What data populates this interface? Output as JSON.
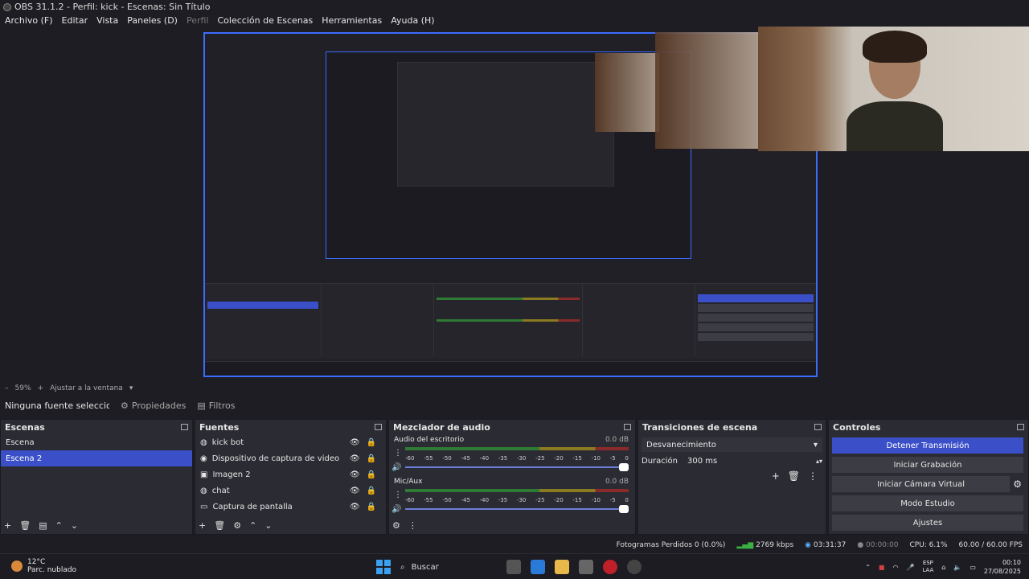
{
  "window": {
    "title": "OBS 31.1.2 - Perfil: kick - Escenas: Sin Título"
  },
  "menu": {
    "items": [
      "Archivo (F)",
      "Editar",
      "Vista",
      "Paneles (D)",
      "Perfil",
      "Colección de Escenas",
      "Herramientas",
      "Ayuda (H)"
    ]
  },
  "preview": {
    "zoom": "59%",
    "fit_label": "Ajustar a la ventana"
  },
  "source_bar": {
    "selected_label": "Ninguna fuente seleccionada",
    "properties_label": "Propiedades",
    "filters_label": "Filtros"
  },
  "scenes": {
    "title": "Escenas",
    "items": [
      {
        "label": "Escena",
        "selected": false
      },
      {
        "label": "Escena 2",
        "selected": true
      }
    ]
  },
  "sources": {
    "title": "Fuentes",
    "items": [
      {
        "label": "kick bot",
        "icon": "globe-icon"
      },
      {
        "label": "Dispositivo de captura de video",
        "icon": "camera-icon"
      },
      {
        "label": "Imagen 2",
        "icon": "image-icon"
      },
      {
        "label": "chat",
        "icon": "globe-icon"
      },
      {
        "label": "Captura de pantalla",
        "icon": "monitor-icon"
      }
    ]
  },
  "mixer": {
    "title": "Mezclador de audio",
    "channels": [
      {
        "name": "Audio del escritorio",
        "db": "0.0 dB"
      },
      {
        "name": "Mic/Aux",
        "db": "0.0 dB"
      }
    ],
    "scale": [
      "-60",
      "-55",
      "-50",
      "-45",
      "-40",
      "-35",
      "-30",
      "-25",
      "-20",
      "-15",
      "-10",
      "-5",
      "0"
    ]
  },
  "transitions": {
    "title": "Transiciones de escena",
    "selected": "Desvanecimiento",
    "duration_label": "Duración",
    "duration_value": "300 ms"
  },
  "controls": {
    "title": "Controles",
    "buttons": [
      "Detener Transmisión",
      "Iniciar Grabación",
      "Iniciar Cámara Virtual",
      "Modo Estudio",
      "Ajustes"
    ]
  },
  "status": {
    "dropped_frames": "Fotogramas Perdidos 0 (0.0%)",
    "bitrate": "2769 kbps",
    "stream_time": "03:31:37",
    "record_time": "00:00:00",
    "cpu": "CPU: 6.1%",
    "fps": "60.00 / 60.00 FPS"
  },
  "taskbar": {
    "weather_temp": "12°C",
    "weather_desc": "Parc. nublado",
    "search_label": "Buscar",
    "lang_top": "ESP",
    "lang_bottom": "LAA",
    "time": "00:10",
    "date": "27/08/2025"
  },
  "colors": {
    "accent": "#3b50c8",
    "panel_bg": "#2b2b33",
    "window_bg": "#1d1d23"
  }
}
